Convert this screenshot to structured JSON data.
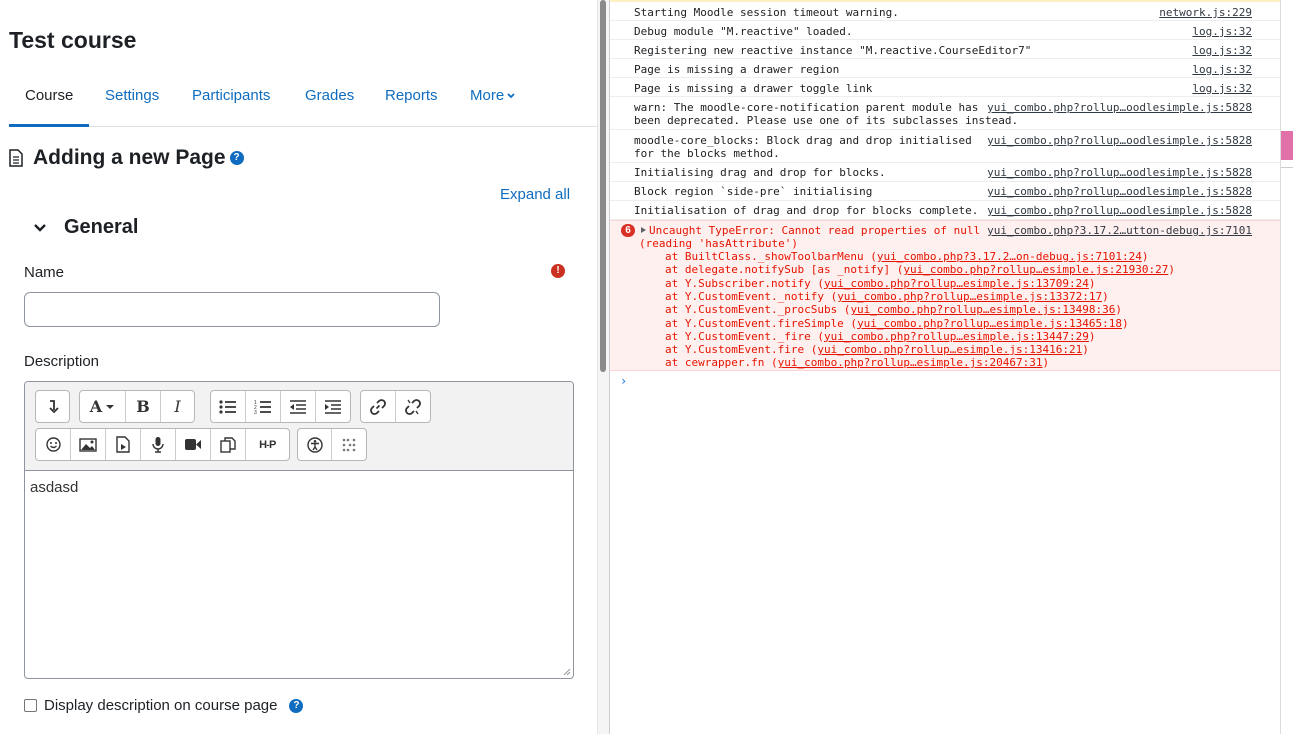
{
  "course": {
    "title": "Test course",
    "nav": [
      {
        "label": "Course",
        "active": true
      },
      {
        "label": "Settings"
      },
      {
        "label": "Participants"
      },
      {
        "label": "Grades"
      },
      {
        "label": "Reports"
      },
      {
        "label": "More"
      }
    ]
  },
  "form": {
    "heading": "Adding a new Page",
    "expand_all": "Expand all",
    "section": "General",
    "name_label": "Name",
    "name_value": "",
    "description_label": "Description",
    "description_content": "asdasd",
    "display_description_label": "Display description on course page",
    "display_description_checked": false
  },
  "editor_toolbar": {
    "row1": [
      [
        "collapse-icon"
      ],
      [
        "font-style-icon",
        "bold-icon",
        "italic-icon"
      ],
      [
        "unordered-list-icon",
        "ordered-list-icon",
        "outdent-icon",
        "indent-icon"
      ],
      [
        "link-icon",
        "unlink-icon"
      ]
    ],
    "row2": [
      [
        "emoji-icon",
        "image-icon",
        "media-icon",
        "record-audio-icon",
        "record-video-icon",
        "manage-files-icon",
        "h5p-icon"
      ],
      [
        "accessibility-checker-icon",
        "screenreader-helper-icon"
      ]
    ]
  },
  "console": {
    "messages": [
      {
        "text": "Starting Moodle session timeout warning.",
        "source": "network.js:229"
      },
      {
        "text": "Debug module \"M.reactive\" loaded.",
        "source": "log.js:32"
      },
      {
        "text": "Registering new reactive instance \"M.reactive.CourseEditor7\"",
        "source": "log.js:32"
      },
      {
        "text": "Page is missing a drawer region",
        "source": "log.js:32"
      },
      {
        "text": "Page is missing a drawer toggle link",
        "source": "log.js:32"
      },
      {
        "text": "warn: The moodle-core-notification parent module has\nbeen deprecated. Please use one of its subclasses instead.",
        "source": "yui_combo.php?rollup…oodlesimple.js:5828"
      },
      {
        "text": "moodle-core_blocks: Block drag and drop initialised\nfor the blocks method.",
        "source": "yui_combo.php?rollup…oodlesimple.js:5828"
      },
      {
        "text": "Initialising drag and drop for blocks.",
        "source": "yui_combo.php?rollup…oodlesimple.js:5828"
      },
      {
        "text": "Block region `side-pre` initialising",
        "source": "yui_combo.php?rollup…oodlesimple.js:5828"
      },
      {
        "text": "Initialisation of drag and drop for blocks complete.",
        "source": "yui_combo.php?rollup…oodlesimple.js:5828"
      }
    ],
    "error": {
      "count": "6",
      "line1": "Uncaught TypeError: Cannot read properties of null",
      "line2": "(reading 'hasAttribute')",
      "source": "yui_combo.php?3.17.2…utton-debug.js:7101",
      "stack": [
        {
          "prefix": "at BuiltClass._showToolbarMenu (",
          "link": "yui_combo.php?3.17.2…on-debug.js:7101:24",
          "suffix": ")"
        },
        {
          "prefix": "at delegate.notifySub [as _notify] (",
          "link": "yui_combo.php?rollup…esimple.js:21930:27",
          "suffix": ")"
        },
        {
          "prefix": "at Y.Subscriber.notify (",
          "link": "yui_combo.php?rollup…esimple.js:13709:24",
          "suffix": ")"
        },
        {
          "prefix": "at Y.CustomEvent._notify (",
          "link": "yui_combo.php?rollup…esimple.js:13372:17",
          "suffix": ")"
        },
        {
          "prefix": "at Y.CustomEvent._procSubs (",
          "link": "yui_combo.php?rollup…esimple.js:13498:36",
          "suffix": ")"
        },
        {
          "prefix": "at Y.CustomEvent.fireSimple (",
          "link": "yui_combo.php?rollup…esimple.js:13465:18",
          "suffix": ")"
        },
        {
          "prefix": "at Y.CustomEvent._fire (",
          "link": "yui_combo.php?rollup…esimple.js:13447:29",
          "suffix": ")"
        },
        {
          "prefix": "at Y.CustomEvent.fire (",
          "link": "yui_combo.php?rollup…esimple.js:13416:21",
          "suffix": ")"
        },
        {
          "prefix": "at cewrapper.fn (",
          "link": "yui_combo.php?rollup…esimple.js:20467:31",
          "suffix": ")"
        }
      ]
    },
    "prompt": "›"
  },
  "colors": {
    "link": "#0f6cbf",
    "required": "#ca3120",
    "error_bg": "#fff0f0",
    "error_text": "#e51400"
  }
}
